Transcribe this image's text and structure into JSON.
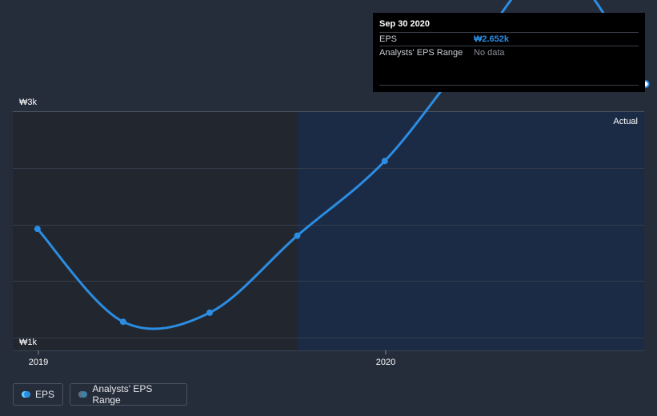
{
  "chart_data": {
    "type": "line",
    "x": [
      "2018-12-31",
      "2019-03-31",
      "2019-06-30",
      "2019-09-30",
      "2019-12-31",
      "2020-03-31",
      "2020-06-30",
      "2020-09-30"
    ],
    "series": [
      {
        "name": "EPS",
        "values": [
          1.96,
          1.14,
          1.22,
          1.9,
          2.56,
          3.51,
          4.29,
          3.24
        ],
        "color": "#2b8de3"
      }
    ],
    "y_axis_labels": [
      {
        "value": 3,
        "label": "₩3k"
      },
      {
        "value": 1,
        "label": "₩1k"
      }
    ],
    "x_axis_labels": [
      {
        "x": "2019-01-01",
        "label": "2019"
      },
      {
        "x": "2020-01-01",
        "label": "2020"
      }
    ],
    "actual_label": "Actual",
    "forecast_divider": "2019-09-30",
    "grid": true
  },
  "tooltip": {
    "date": "Sep 30 2020",
    "rows": [
      {
        "key": "EPS",
        "value": "₩2.652k"
      },
      {
        "key": "Analysts' EPS Range",
        "value": "No data"
      }
    ]
  },
  "legend": {
    "items": [
      {
        "label": "EPS",
        "color": "#2b8de3"
      },
      {
        "label": "Analysts' EPS Range",
        "color": "#3f7fa8"
      }
    ]
  },
  "colors": {
    "background": "#262d3a",
    "past_region": "#22272f",
    "actual_region": "#1b2b45",
    "line": "#2b8de3"
  }
}
